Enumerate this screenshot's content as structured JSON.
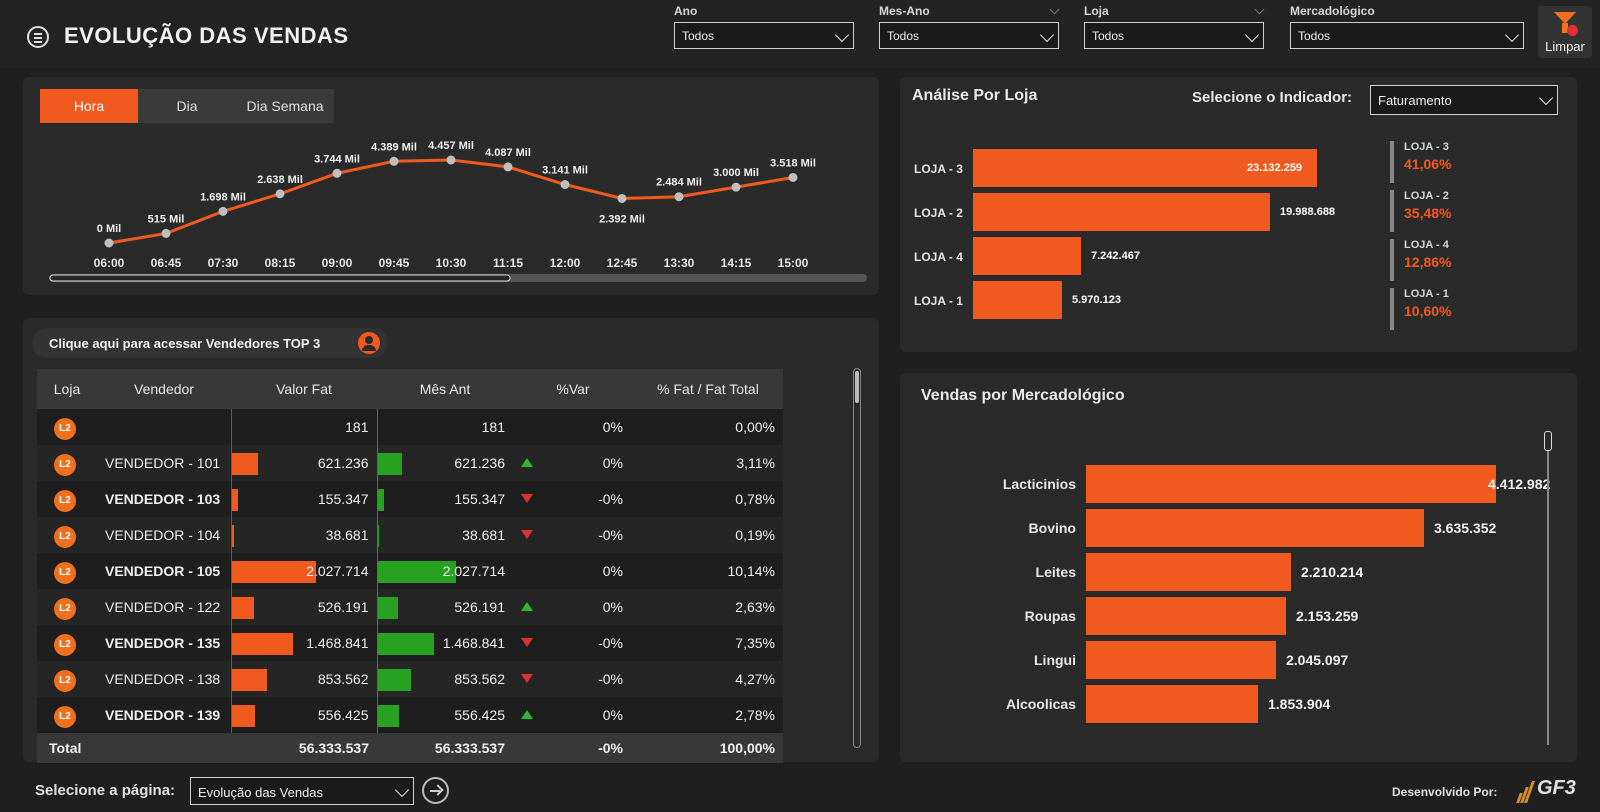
{
  "header": {
    "title": "EVOLUÇÃO DAS VENDAS",
    "filters": [
      {
        "label": "Ano",
        "value": "Todos"
      },
      {
        "label": "Mes-Ano",
        "value": "Todos"
      },
      {
        "label": "Loja",
        "value": "Todos"
      },
      {
        "label": "Mercadológico",
        "value": "Todos"
      }
    ],
    "clear_label": "Limpar"
  },
  "time_chart": {
    "tabs": [
      "Hora",
      "Dia",
      "Dia Semana"
    ],
    "active_tab": "Hora",
    "colors": {
      "accent": "#f05a1e",
      "point": "#bfbfbf"
    }
  },
  "chart_data": [
    {
      "type": "line",
      "x": [
        "06:00",
        "06:45",
        "07:30",
        "08:15",
        "09:00",
        "09:45",
        "10:30",
        "11:15",
        "12:00",
        "12:45",
        "13:30",
        "14:15",
        "15:00"
      ],
      "values": [
        0,
        515,
        1698,
        2638,
        3744,
        4389,
        4457,
        4087,
        3141,
        2392,
        2484,
        3000,
        3518
      ],
      "data_labels": [
        "0 Mil",
        "515 Mil",
        "1.698 Mil",
        "2.638 Mil",
        "3.744 Mil",
        "4.389 Mil",
        "4.457 Mil",
        "4.087 Mil",
        "3.141 Mil",
        "2.392 Mil",
        "2.484 Mil",
        "3.000 Mil",
        "3.518 Mil"
      ],
      "grid": false
    },
    {
      "type": "bar",
      "title": "Análise Por Loja",
      "categories": [
        "LOJA - 3",
        "LOJA - 2",
        "LOJA - 4",
        "LOJA - 1"
      ],
      "values": [
        23132259,
        19988688,
        7242467,
        5970123
      ],
      "data_labels": [
        "23.132.259",
        "19.988.688",
        "7.242.467",
        "5.970.123"
      ],
      "orientation": "horizontal"
    },
    {
      "type": "bar",
      "title": "Vendas por Mercadológico",
      "categories": [
        "Lacticinios",
        "Bovino",
        "Leites",
        "Roupas",
        "Lingui",
        "Alcoolicas"
      ],
      "values": [
        4412982,
        3635352,
        2210214,
        2153259,
        2045097,
        1853904
      ],
      "data_labels": [
        "4.412.982",
        "3.635.352",
        "2.210.214",
        "2.153.259",
        "2.045.097",
        "1.853.904"
      ],
      "orientation": "horizontal"
    }
  ],
  "sellers": {
    "top3_label": "Clique aqui para acessar Vendedores TOP 3",
    "columns": [
      "Loja",
      "Vendedor",
      "Valor Fat",
      "Mês Ant",
      "%Var",
      "% Fat / Fat Total"
    ],
    "rows": [
      {
        "loja": "L2",
        "vendedor": "",
        "valor": "181",
        "valor_frac": 0,
        "mes": "181",
        "trend": "",
        "var": "0%",
        "pct": "0,00%",
        "bold": false
      },
      {
        "loja": "L2",
        "vendedor": "VENDEDOR - 101",
        "valor": "621.236",
        "valor_frac": 0.306,
        "mes": "621.236",
        "trend": "up",
        "var": "0%",
        "pct": "3,11%",
        "bold": false
      },
      {
        "loja": "L2",
        "vendedor": "VENDEDOR - 103",
        "valor": "155.347",
        "valor_frac": 0.077,
        "mes": "155.347",
        "trend": "down",
        "var": "-0%",
        "pct": "0,78%",
        "bold": true
      },
      {
        "loja": "L2",
        "vendedor": "VENDEDOR - 104",
        "valor": "38.681",
        "valor_frac": 0.019,
        "mes": "38.681",
        "trend": "down",
        "var": "-0%",
        "pct": "0,19%",
        "bold": false
      },
      {
        "loja": "L2",
        "vendedor": "VENDEDOR - 105",
        "valor": "2.027.714",
        "valor_frac": 1.0,
        "mes": "2.027.714",
        "trend": "",
        "var": "0%",
        "pct": "10,14%",
        "bold": true
      },
      {
        "loja": "L2",
        "vendedor": "VENDEDOR - 122",
        "valor": "526.191",
        "valor_frac": 0.26,
        "mes": "526.191",
        "trend": "up",
        "var": "0%",
        "pct": "2,63%",
        "bold": false
      },
      {
        "loja": "L2",
        "vendedor": "VENDEDOR - 135",
        "valor": "1.468.841",
        "valor_frac": 0.724,
        "mes": "1.468.841",
        "trend": "down",
        "var": "-0%",
        "pct": "7,35%",
        "bold": true
      },
      {
        "loja": "L2",
        "vendedor": "VENDEDOR - 138",
        "valor": "853.562",
        "valor_frac": 0.421,
        "mes": "853.562",
        "trend": "down",
        "var": "-0%",
        "pct": "4,27%",
        "bold": false
      },
      {
        "loja": "L2",
        "vendedor": "VENDEDOR - 139",
        "valor": "556.425",
        "valor_frac": 0.274,
        "mes": "556.425",
        "trend": "up",
        "var": "0%",
        "pct": "2,78%",
        "bold": true
      }
    ],
    "total": {
      "label": "Total",
      "valor": "56.333.537",
      "mes": "56.333.537",
      "var": "-0%",
      "pct": "100,00%"
    }
  },
  "stores": {
    "title": "Análise Por Loja",
    "indicator_label": "Selecione o Indicador:",
    "indicator_value": "Faturamento",
    "shares": [
      {
        "name": "LOJA - 3",
        "pct": "41,06%"
      },
      {
        "name": "LOJA - 2",
        "pct": "35,48%"
      },
      {
        "name": "LOJA - 4",
        "pct": "12,86%"
      },
      {
        "name": "LOJA - 1",
        "pct": "10,60%"
      }
    ]
  },
  "merc": {
    "title": "Vendas por Mercadológico"
  },
  "footer": {
    "page_label": "Selecione a página:",
    "page_value": "Evolução das Vendas",
    "dev_label": "Desenvolvido Por:",
    "logo_text": "GF3"
  }
}
